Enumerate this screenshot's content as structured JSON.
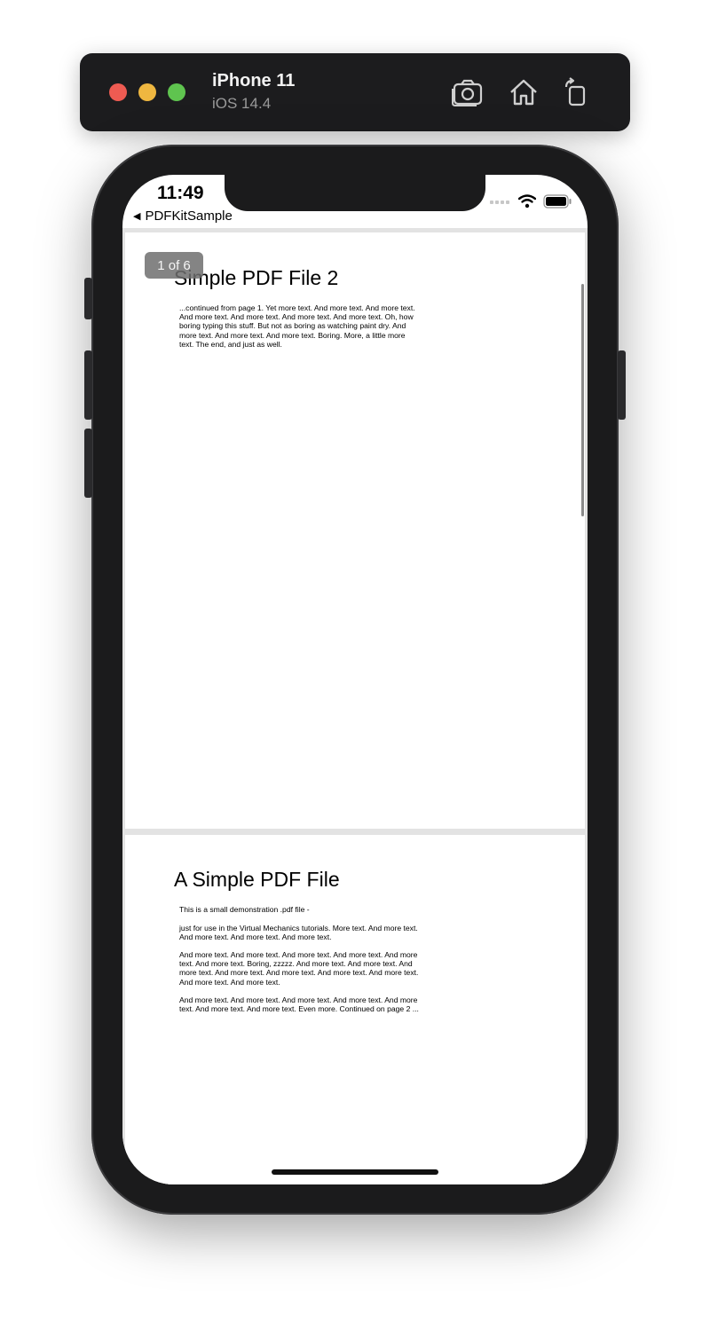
{
  "simulator": {
    "device": "iPhone 11",
    "os": "iOS 14.4",
    "icons": [
      "screenshot-icon",
      "home-icon",
      "rotate-icon"
    ]
  },
  "status_bar": {
    "time": "11:49",
    "back_label": "PDFKitSample",
    "icons": [
      "cellular-icon",
      "wifi-icon",
      "battery-icon"
    ]
  },
  "pdf": {
    "page_indicator": "1 of 6",
    "pages": [
      {
        "title": "Simple PDF File 2",
        "paragraphs": [
          "...continued from page 1. Yet more text. And more text. And more text. And more text. And more text. And more text. And more text. Oh, how boring typing this stuff. But not as boring as watching paint dry. And more text. And more text. And more text. Boring. More, a little more text. The end, and just as well."
        ]
      },
      {
        "title": "A Simple PDF File",
        "paragraphs": [
          "This is a small demonstration .pdf file -",
          "just for use in the Virtual Mechanics tutorials. More text. And more text. And more text. And more text. And more text.",
          "And more text. And more text. And more text. And more text. And more text. And more text. Boring, zzzzz. And more text. And more text. And more text. And more text. And more text. And more text. And more text. And more text. And more text.",
          "And more text. And more text. And more text. And more text. And more text. And more text. And more text. Even more. Continued on page 2 ..."
        ]
      }
    ]
  },
  "colors": {
    "simulator_bar": "#1c1c1e",
    "phone_frame": "#1b1b1c",
    "page_background": "#e3e3e3",
    "indicator": "#6e6e6e"
  }
}
